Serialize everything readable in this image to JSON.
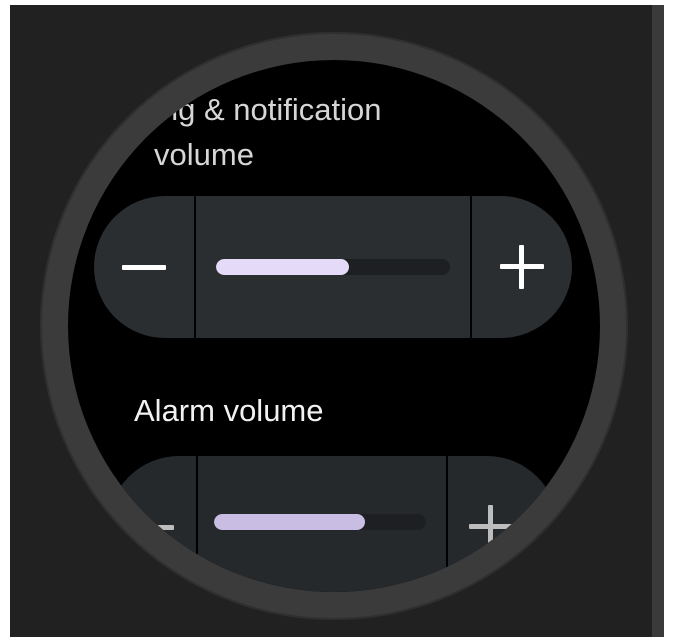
{
  "ring_notification": {
    "title_visible": "ing & notification",
    "title_line2": "volume",
    "level_fraction": 0.57,
    "decrease_icon": "minus-icon",
    "increase_icon": "plus-icon"
  },
  "alarm": {
    "title": "Alarm volume",
    "level_fraction": 0.71,
    "decrease_icon": "minus-icon",
    "increase_icon": "plus-icon"
  },
  "colors": {
    "fill_primary": "#e5dbf8",
    "fill_secondary": "#c9bde3",
    "control_bg": "#2b2e31",
    "screen_bg": "#000000"
  }
}
